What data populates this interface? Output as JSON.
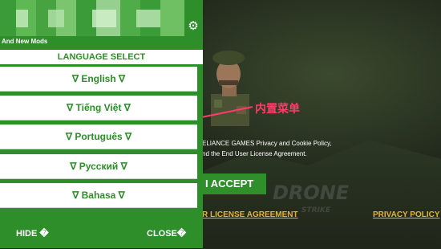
{
  "mod_menu": {
    "subtitle": "And New Mods",
    "section_title": "LANGUAGE SELECT",
    "languages": [
      "∇ English ∇",
      "∇ Tiếng Việt ∇",
      "∇ Português ∇",
      "∇ Русский ∇",
      "∇ Bahasa ∇"
    ],
    "hide_label": "HIDE �",
    "close_label": "CLOSE�"
  },
  "game": {
    "policy_line1": "ELIANCE GAMES Privacy and Cookie Policy,",
    "policy_line2": "nd the End User License Agreement.",
    "accept_label": "I ACCEPT",
    "eula_link": "R LICENSE AGREEMENT",
    "privacy_link": "PRIVACY POLICY",
    "logo_text": "DRONE",
    "logo_subtext": "STRIKE"
  },
  "annotation": {
    "label": "内置菜单"
  },
  "colors": {
    "panel_green": "#2d8e2a",
    "link_gold": "#e0b534",
    "annotation_red": "#ff3b6b"
  }
}
